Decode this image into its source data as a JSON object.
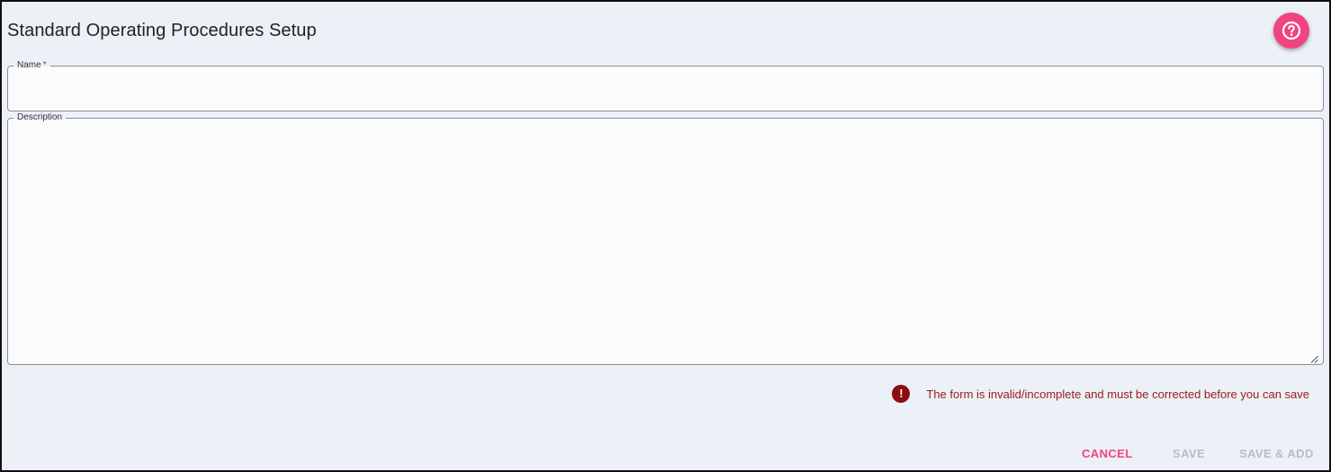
{
  "page": {
    "title": "Standard Operating Procedures Setup"
  },
  "help": {
    "icon": "help-circle-icon",
    "color": "#f0437f"
  },
  "form": {
    "name": {
      "label": "Name",
      "required_mark": "*",
      "value": ""
    },
    "description": {
      "label": "Description",
      "value": ""
    }
  },
  "validation": {
    "icon": "error-icon",
    "icon_glyph": "!",
    "message": "The form is invalid/incomplete and must be corrected before you can save",
    "color": "#9a1a1a"
  },
  "actions": {
    "cancel_label": "CANCEL",
    "save_label": "SAVE",
    "save_add_label": "SAVE & ADD",
    "accent_color": "#f0437f",
    "disabled_color": "#b9bdc4"
  }
}
